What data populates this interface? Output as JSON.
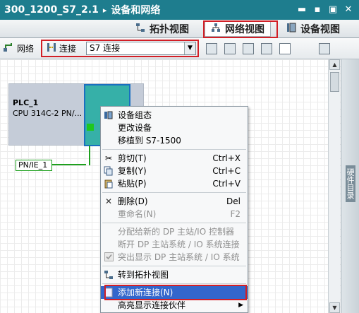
{
  "window": {
    "project": "300_1200_S7_2.1",
    "breadcrumb_sep": "▸",
    "section": "设备和网络",
    "controls": [
      "▬",
      "▪",
      "▣",
      "✕"
    ]
  },
  "view_tabs": [
    {
      "label": "拓扑视图",
      "icon": "topology-icon"
    },
    {
      "label": "网络视图",
      "icon": "network-icon"
    },
    {
      "label": "设备视图",
      "icon": "device-icon"
    }
  ],
  "toolbar": {
    "network_label": "网络",
    "connect_label": "连接",
    "connection_type": "S7 连接"
  },
  "canvas": {
    "plc_name": "PLC_1",
    "plc_model": "CPU 314C-2 PN/...",
    "subnet": "PN/IE_1"
  },
  "side_panel": {
    "label": "硬件目录"
  },
  "context_menu": {
    "items": [
      {
        "label": "设备组态",
        "icon": "device-config-icon",
        "shortcut": "",
        "disabled": false
      },
      {
        "label": "更改设备",
        "icon": "",
        "shortcut": "",
        "disabled": false
      },
      {
        "label": "移植到 S7-1500",
        "icon": "",
        "shortcut": "",
        "disabled": false
      },
      {
        "label": "剪切(T)",
        "icon": "cut-icon",
        "shortcut": "Ctrl+X",
        "disabled": false
      },
      {
        "label": "复制(Y)",
        "icon": "copy-icon",
        "shortcut": "Ctrl+C",
        "disabled": false
      },
      {
        "label": "粘贴(P)",
        "icon": "paste-icon",
        "shortcut": "Ctrl+V",
        "disabled": false
      },
      {
        "label": "删除(D)",
        "icon": "delete-icon",
        "shortcut": "Del",
        "disabled": false
      },
      {
        "label": "重命名(N)",
        "icon": "",
        "shortcut": "F2",
        "disabled": true
      },
      {
        "label": "分配给新的 DP 主站/IO 控制器",
        "icon": "",
        "shortcut": "",
        "disabled": true
      },
      {
        "label": "断开 DP 主站系统 / IO 系统连接",
        "icon": "",
        "shortcut": "",
        "disabled": true
      },
      {
        "label": "突出显示 DP 主站系统 / IO 系统",
        "icon": "checkbox-icon",
        "shortcut": "",
        "disabled": true
      },
      {
        "label": "转到拓扑视图",
        "icon": "topology-icon",
        "shortcut": "",
        "disabled": false
      },
      {
        "label": "添加新连接(N)",
        "icon": "",
        "shortcut": "",
        "disabled": false,
        "highlighted": true
      },
      {
        "label": "高亮显示连接伙伴",
        "icon": "",
        "shortcut": "",
        "disabled": false,
        "submenu": true
      }
    ]
  },
  "colors": {
    "title_bar": "#1e7d8e",
    "highlight_box": "#d21f26",
    "menu_highlight": "#3366cc",
    "subnet_green": "#1ea01e"
  }
}
